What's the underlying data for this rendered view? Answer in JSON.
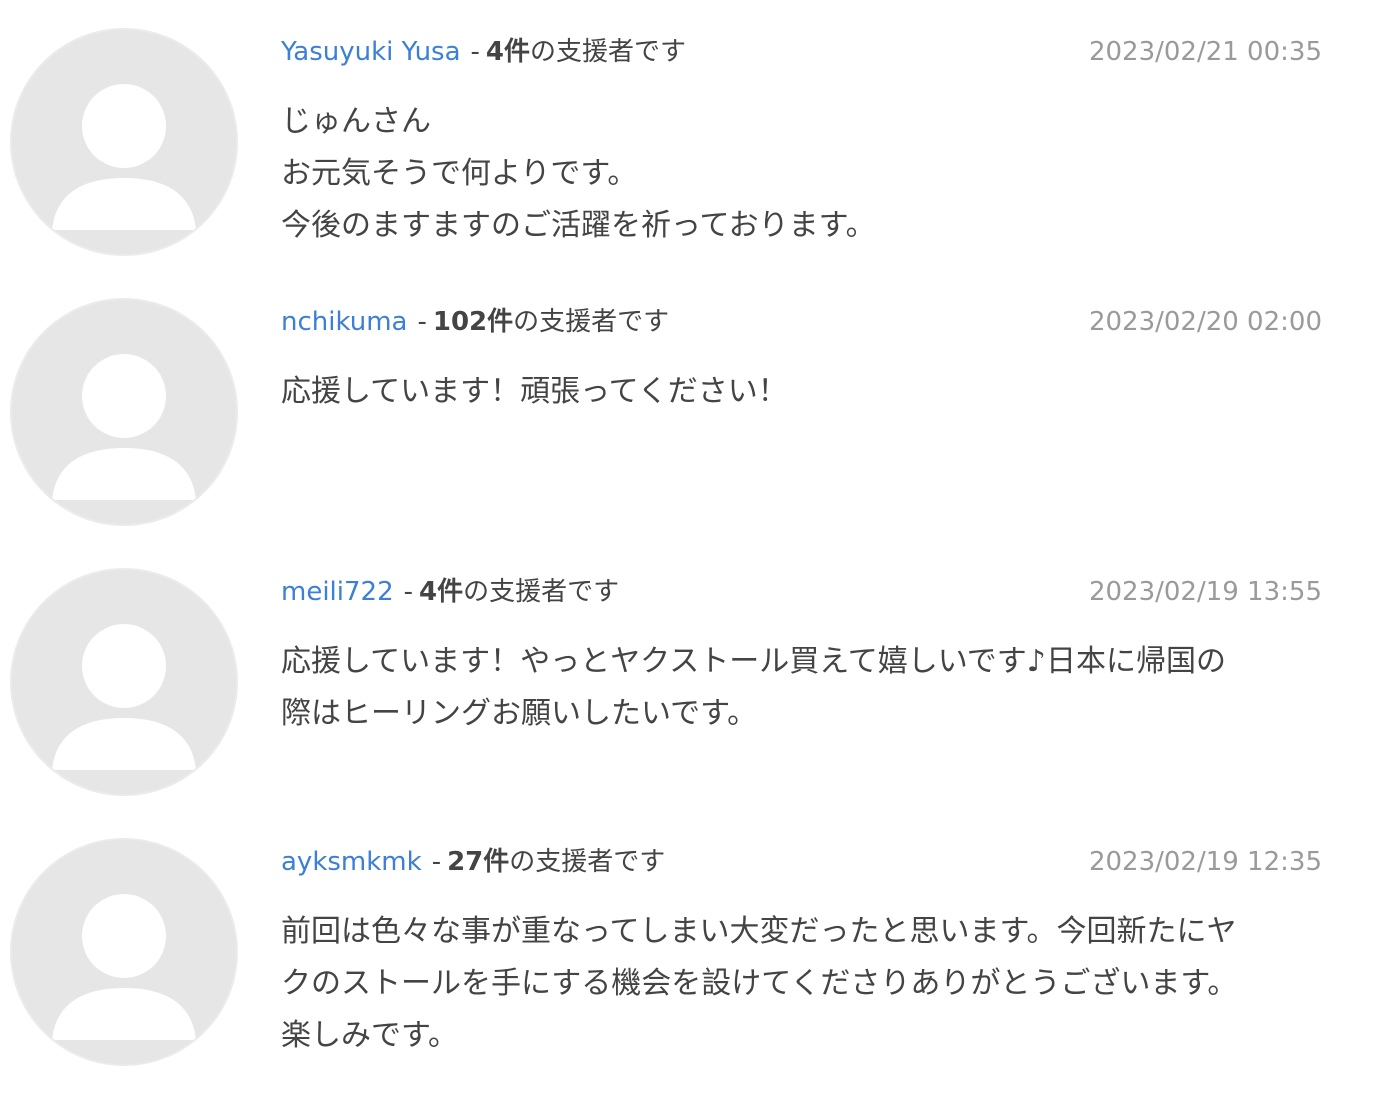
{
  "colors": {
    "username": "#3b7fd6",
    "text": "#444444",
    "date": "#9a9a9a",
    "avatar_bg": "#e6e6e6",
    "avatar_fg": "#ffffff"
  },
  "comments": [
    {
      "username": "Yasuyuki Yusa",
      "separator": "-",
      "count": "4件",
      "supporter_text": "の支援者です",
      "date": "2023/02/21 00:35",
      "lines": [
        "じゅんさん",
        "お元気そうで何よりです。",
        "今後のますますのご活躍を祈っております。"
      ]
    },
    {
      "username": "nchikuma",
      "separator": "-",
      "count": "102件",
      "supporter_text": "の支援者です",
      "date": "2023/02/20 02:00",
      "lines": [
        "応援しています！頑張ってください！"
      ]
    },
    {
      "username": "meili722",
      "separator": "-",
      "count": "4件",
      "supporter_text": "の支援者です",
      "date": "2023/02/19 13:55",
      "lines": [
        "応援しています！やっとヤクストール買えて嬉しいです♪日本に帰国の",
        "際はヒーリングお願いしたいです。"
      ]
    },
    {
      "username": "ayksmkmk",
      "separator": "-",
      "count": "27件",
      "supporter_text": "の支援者です",
      "date": "2023/02/19 12:35",
      "lines": [
        "前回は色々な事が重なってしまい大変だったと思います。今回新たにヤ",
        "クのストールを手にする機会を設けてくださりありがとうございます。",
        "楽しみです。"
      ]
    }
  ]
}
